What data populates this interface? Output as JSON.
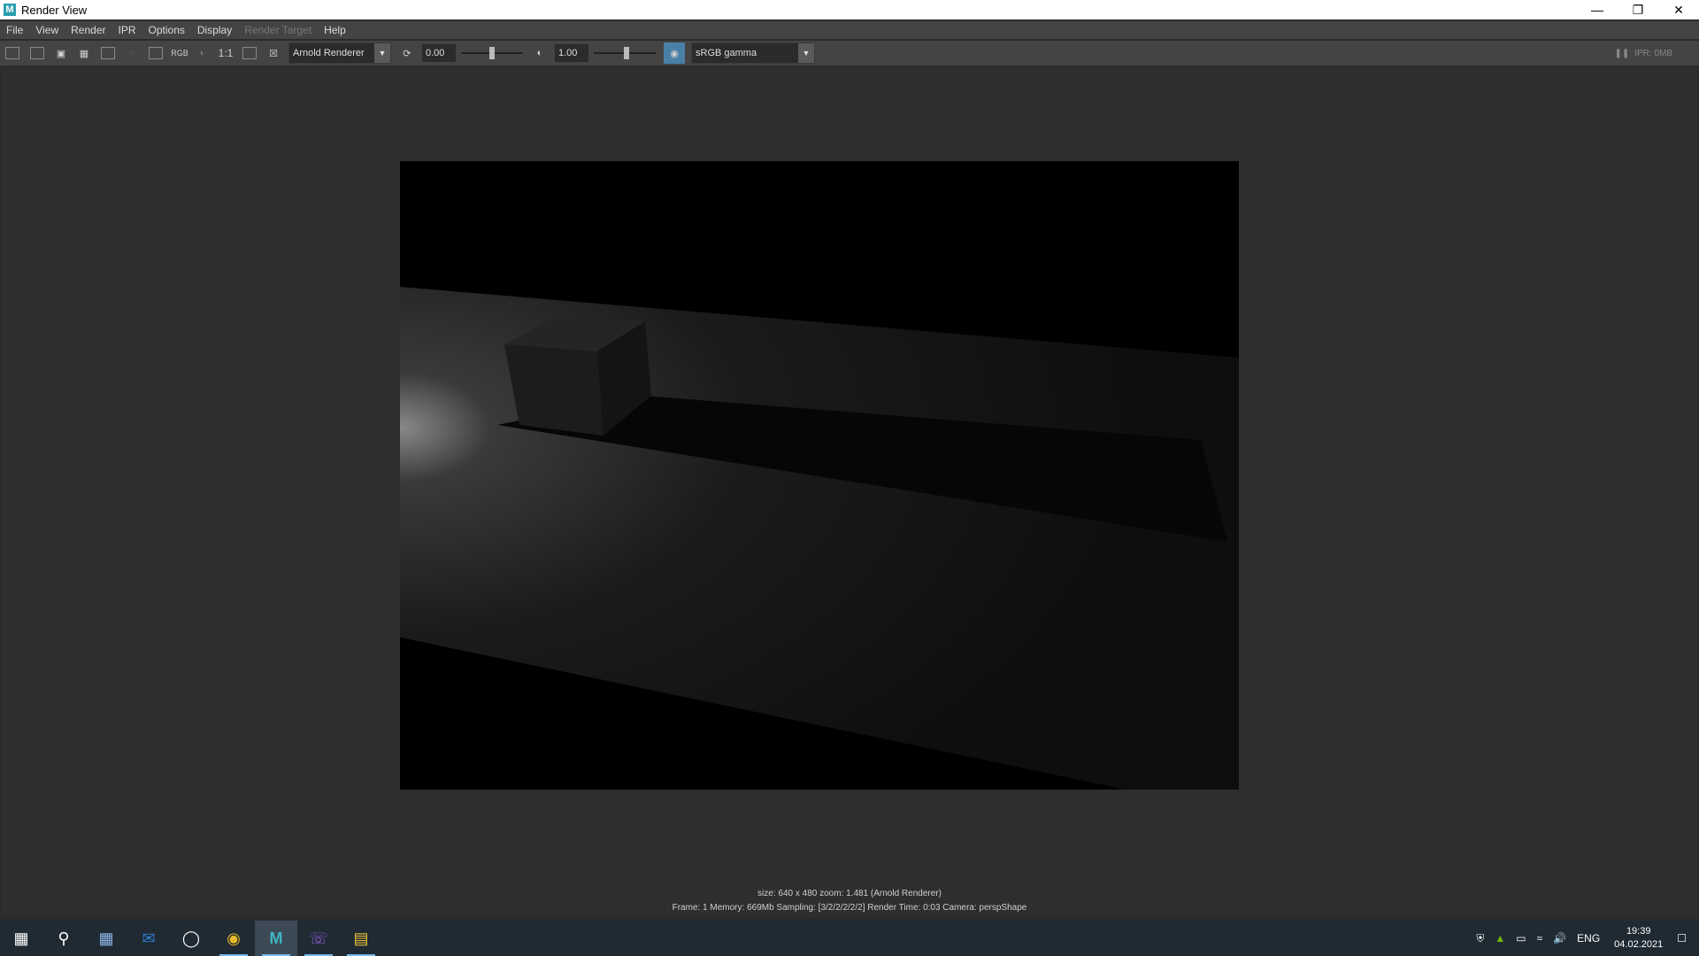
{
  "window": {
    "title": "Render View",
    "app_icon_letter": "M",
    "controls": [
      "minimize-icon",
      "restore-icon",
      "close-icon"
    ]
  },
  "menu": {
    "items": [
      {
        "label": "File",
        "enabled": true
      },
      {
        "label": "View",
        "enabled": true
      },
      {
        "label": "Render",
        "enabled": true
      },
      {
        "label": "IPR",
        "enabled": true
      },
      {
        "label": "Options",
        "enabled": true
      },
      {
        "label": "Display",
        "enabled": true
      },
      {
        "label": "Render Target",
        "enabled": false
      },
      {
        "label": "Help",
        "enabled": true
      }
    ]
  },
  "toolbar": {
    "rgb_label": "RGB",
    "ratio_label": "1:1",
    "renderer": "Arnold Renderer",
    "exposure_value": "0.00",
    "gamma_value": "1.00",
    "colorspace": "sRGB gamma",
    "ipr_status": "IPR: 0MB"
  },
  "render_info": {
    "line1": "size: 640 x 480 zoom: 1.481     (Arnold Renderer)",
    "line2": "Frame: 1     Memory: 669Mb     Sampling: [3/2/2/2/2/2]     Render Time: 0:03     Camera: perspShape"
  },
  "taskbar": {
    "items": [
      "windows-start-icon",
      "search-icon",
      "calculator-icon",
      "mail-icon",
      "cortana-icon",
      "chrome-icon",
      "maya-icon",
      "viber-icon",
      "file-explorer-icon"
    ],
    "language": "ENG",
    "time": "19:39",
    "date": "04.02.2021"
  },
  "colors": {
    "viewport_bg": "#2e2e2e",
    "toolbar_bg": "#444444",
    "taskbar_bg": "#1f2a33"
  }
}
